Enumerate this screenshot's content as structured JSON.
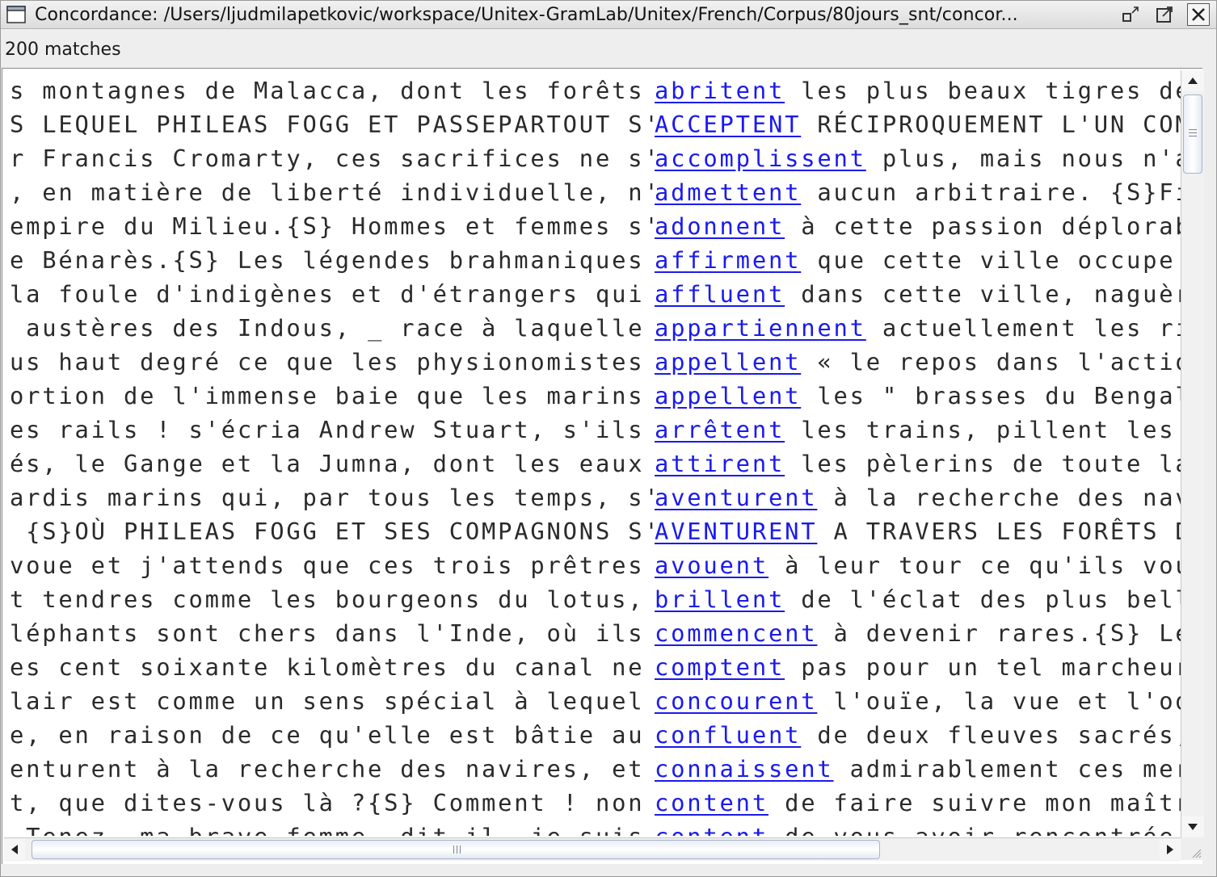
{
  "window": {
    "title": "Concordance: /Users/ljudmilapetkovic/workspace/Unitex-GramLab/Unitex/French/Corpus/80jours_snt/concor...",
    "icon": "window-icon",
    "buttons": [
      "iconify-icon",
      "maximize-icon",
      "close-icon"
    ]
  },
  "status": {
    "matches_label": "200 matches"
  },
  "concordance": {
    "match_color": "#1a1aee",
    "lines": [
      {
        "left": "s montagnes de Malacca, dont les forêts ",
        "match": "abritent",
        "right": " les plus beaux tigres de"
      },
      {
        "left": "S LEQUEL PHILEAS FOGG ET PASSEPARTOUT S'",
        "match": "ACCEPTENT",
        "right": " RÉCIPROQUEMENT L'UN COM"
      },
      {
        "left": "r Francis Cromarty, ces sacrifices ne s'",
        "match": "accomplissent",
        "right": " plus, mais nous n'a"
      },
      {
        "left": ", en matière de liberté individuelle, n'",
        "match": "admettent",
        "right": " aucun arbitraire. {S}Fi"
      },
      {
        "left": "empire du Milieu.{S} Hommes et femmes s'",
        "match": "adonnent",
        "right": " à cette passion déplorab"
      },
      {
        "left": "e Bénarès.{S} Les légendes brahmaniques ",
        "match": "affirment",
        "right": " que cette ville occupe"
      },
      {
        "left": "la foule d'indigènes et d'étrangers qui ",
        "match": "affluent",
        "right": " dans cette ville, naguèr"
      },
      {
        "left": " austères des Indous, _ race à laquelle ",
        "match": "appartiennent",
        "right": " actuellement les ri"
      },
      {
        "left": "us haut degré ce que les physionomistes ",
        "match": "appellent",
        "right": " « le repos dans l'actio"
      },
      {
        "left": "ortion de l'immense baie que les marins ",
        "match": "appellent",
        "right": " les \" brasses du Bengal"
      },
      {
        "left": "es rails ! s'écria Andrew Stuart, s'ils ",
        "match": "arrêtent",
        "right": " les trains, pillent les"
      },
      {
        "left": "és, le Gange et la Jumna, dont les eaux ",
        "match": "attirent",
        "right": " les pèlerins de toute la"
      },
      {
        "left": "ardis marins qui, par tous les temps, s'",
        "match": "aventurent",
        "right": " à la recherche des nav"
      },
      {
        "left": " {S}OÙ PHILEAS FOGG ET SES COMPAGNONS S'",
        "match": "AVENTURENT",
        "right": " A TRAVERS LES FORÊTS D"
      },
      {
        "left": "voue et j'attends que ces trois prêtres ",
        "match": "avouent",
        "right": " à leur tour ce qu'ils vou"
      },
      {
        "left": "t tendres comme les bourgeons du lotus, ",
        "match": "brillent",
        "right": " de l'éclat des plus bell"
      },
      {
        "left": "léphants sont chers dans l'Inde, où ils ",
        "match": "commencent",
        "right": " à devenir rares.{S} Le"
      },
      {
        "left": "es cent soixante kilomètres du canal ne ",
        "match": "comptent",
        "right": " pas pour un tel marcheur"
      },
      {
        "left": "lair est comme un sens spécial à lequel ",
        "match": "concourent",
        "right": " l'ouïe, la vue et l'od"
      },
      {
        "left": "e, en raison de ce qu'elle est bâtie au ",
        "match": "confluent",
        "right": " de deux fleuves sacrés,"
      },
      {
        "left": "enturent à la recherche des navires, et ",
        "match": "connaissent",
        "right": " admirablement ces mer"
      },
      {
        "left": "t, que dites-vous là ?{S} Comment ! non ",
        "match": "content",
        "right": " de faire suivre mon maîtr"
      },
      {
        "left": " Tenez, ma brave femme, dit-il, je suis ",
        "match": "content",
        "right": " de vous avoir rencontrée"
      }
    ]
  },
  "scrollbars": {
    "vertical": {
      "up_icon": "scroll-up-arrow-icon",
      "down_icon": "scroll-down-arrow-icon",
      "position": 0.0
    },
    "horizontal": {
      "left_icon": "scroll-left-arrow-icon",
      "right_icon": "scroll-right-arrow-icon",
      "position": 0.0
    }
  }
}
